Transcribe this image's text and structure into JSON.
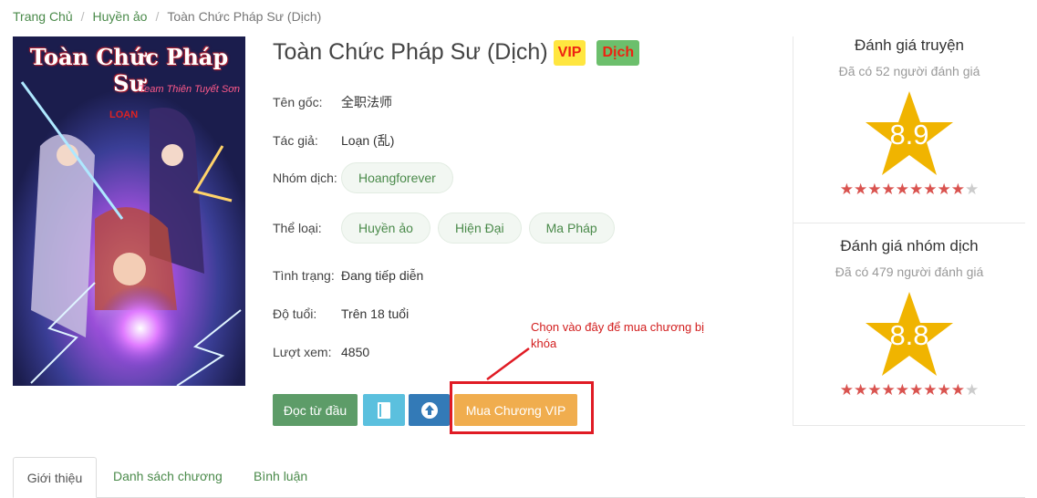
{
  "breadcrumb": {
    "home": "Trang Chủ",
    "category": "Huyền ảo",
    "current": "Toàn Chức Pháp Sư (Dịch)"
  },
  "cover": {
    "title": "Toàn Chức Pháp Sư",
    "subtitle": "Team Thiên Tuyết Sơn",
    "author_tag": "LOẠN"
  },
  "story": {
    "title": "Toàn Chức Pháp Sư (Dịch)",
    "badge_vip": "VIP",
    "badge_dich": "Dịch",
    "original_name_label": "Tên gốc:",
    "original_name": "全职法师",
    "author_label": "Tác giả:",
    "author": "Loạn (乱)",
    "group_label": "Nhóm dịch:",
    "group": "Hoangforever",
    "genre_label": "Thể loại:",
    "genres": [
      "Huyền ảo",
      "Hiện Đại",
      "Ma Pháp"
    ],
    "status_label": "Tình trạng:",
    "status": "Đang tiếp diễn",
    "age_label": "Độ tuổi:",
    "age": "Trên 18 tuổi",
    "views_label": "Lượt xem:",
    "views": "4850"
  },
  "buttons": {
    "read": "Đọc từ đầu",
    "buy": "Mua Chương VIP",
    "book_icon": "book-icon",
    "upload_icon": "arrow-up-circle-icon"
  },
  "annotation": {
    "note": "Chọn vào đây để mua chương bị khóa",
    "color": "#e01b24"
  },
  "ratings": {
    "story": {
      "title": "Đánh giá truyện",
      "count": "Đã có 52 người đánh giá",
      "score": "8.9",
      "stars_on": 9,
      "stars_total": 10
    },
    "group": {
      "title": "Đánh giá nhóm dịch",
      "count": "Đã có 479 người đánh giá",
      "score": "8.8",
      "stars_on": 9,
      "stars_total": 10
    }
  },
  "tabs": [
    "Giới thiệu",
    "Danh sách chương",
    "Bình luận"
  ],
  "colors": {
    "accent_green": "#5d9c68",
    "vip_yellow": "#ffe640",
    "buy_orange": "#f0ad4e",
    "star_gold": "#f0b400",
    "star_red": "#d9534f"
  }
}
